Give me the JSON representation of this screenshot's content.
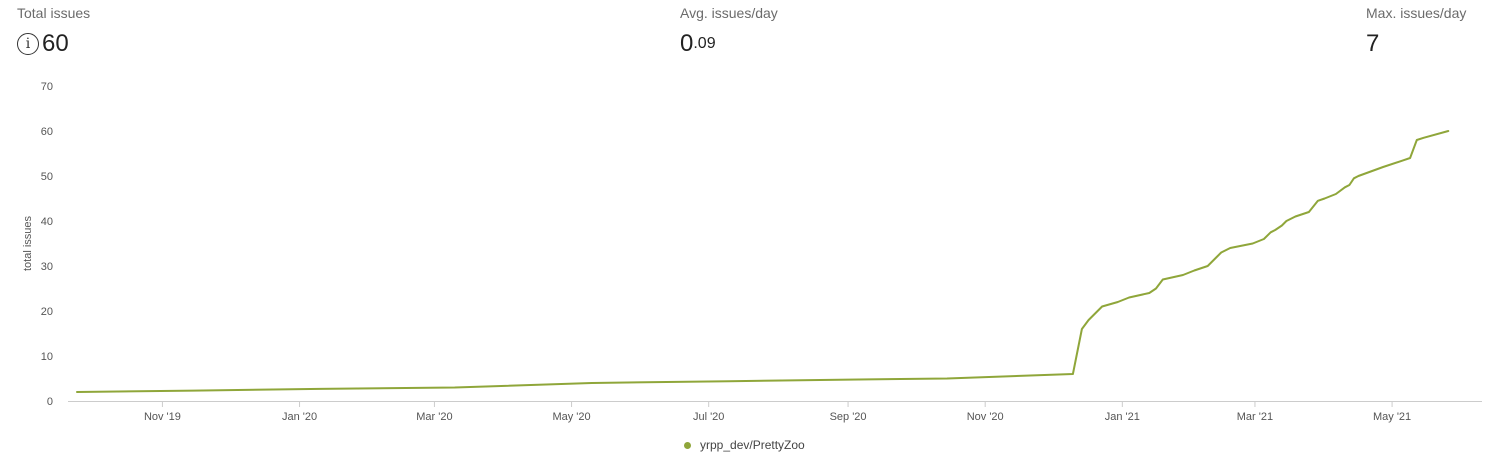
{
  "stats": {
    "total": {
      "label": "Total issues",
      "value": "60",
      "icon": "info-icon",
      "icon_glyph": "i"
    },
    "avg": {
      "label": "Avg. issues/day",
      "int_part": "0",
      "frac_part": ".09"
    },
    "max": {
      "label": "Max. issues/day",
      "value": "7"
    }
  },
  "colors": {
    "series": "#8fa63a",
    "axis": "#cccccc"
  },
  "chart_data": {
    "type": "line",
    "title": "",
    "xlabel": "",
    "ylabel": "total issues",
    "ylim": [
      0,
      70
    ],
    "xlim": [
      "2019-09-20",
      "2021-06-10"
    ],
    "y_ticks": [
      0,
      10,
      20,
      30,
      40,
      50,
      60,
      70
    ],
    "x_ticks": [
      {
        "date": "2019-11-01",
        "label": "Nov '19"
      },
      {
        "date": "2020-01-01",
        "label": "Jan '20"
      },
      {
        "date": "2020-03-01",
        "label": "Mar '20"
      },
      {
        "date": "2020-05-01",
        "label": "May '20"
      },
      {
        "date": "2020-07-01",
        "label": "Jul '20"
      },
      {
        "date": "2020-09-01",
        "label": "Sep '20"
      },
      {
        "date": "2020-11-01",
        "label": "Nov '20"
      },
      {
        "date": "2021-01-01",
        "label": "Jan '21"
      },
      {
        "date": "2021-03-01",
        "label": "Mar '21"
      },
      {
        "date": "2021-05-01",
        "label": "May '21"
      }
    ],
    "grid": false,
    "legend": "bottom",
    "series": [
      {
        "name": "yrpp_dev/PrettyZoo",
        "color": "#8fa63a",
        "points": [
          [
            "2019-09-24",
            2
          ],
          [
            "2019-11-15",
            2.3
          ],
          [
            "2020-01-10",
            2.7
          ],
          [
            "2020-03-10",
            3
          ],
          [
            "2020-05-10",
            4
          ],
          [
            "2020-07-10",
            4.4
          ],
          [
            "2020-09-10",
            4.8
          ],
          [
            "2020-10-15",
            5
          ],
          [
            "2020-12-10",
            6
          ],
          [
            "2020-12-14",
            16
          ],
          [
            "2020-12-17",
            18
          ],
          [
            "2020-12-19",
            19
          ],
          [
            "2020-12-23",
            21
          ],
          [
            "2020-12-30",
            22
          ],
          [
            "2021-01-04",
            23
          ],
          [
            "2021-01-13",
            24
          ],
          [
            "2021-01-16",
            25
          ],
          [
            "2021-01-19",
            27
          ],
          [
            "2021-01-28",
            28
          ],
          [
            "2021-02-02",
            29
          ],
          [
            "2021-02-08",
            30
          ],
          [
            "2021-02-12",
            32
          ],
          [
            "2021-02-14",
            33
          ],
          [
            "2021-02-18",
            34
          ],
          [
            "2021-02-28",
            35
          ],
          [
            "2021-03-05",
            36
          ],
          [
            "2021-03-08",
            37.5
          ],
          [
            "2021-03-10",
            38
          ],
          [
            "2021-03-13",
            39
          ],
          [
            "2021-03-15",
            40
          ],
          [
            "2021-03-19",
            41
          ],
          [
            "2021-03-25",
            42
          ],
          [
            "2021-03-29",
            44.5
          ],
          [
            "2021-04-01",
            45
          ],
          [
            "2021-04-06",
            46
          ],
          [
            "2021-04-10",
            47.5
          ],
          [
            "2021-04-12",
            48
          ],
          [
            "2021-04-14",
            49.5
          ],
          [
            "2021-04-16",
            50
          ],
          [
            "2021-04-27",
            52
          ],
          [
            "2021-05-06",
            53.5
          ],
          [
            "2021-05-09",
            54
          ],
          [
            "2021-05-12",
            58
          ],
          [
            "2021-05-15",
            58.5
          ],
          [
            "2021-05-26",
            60
          ]
        ]
      }
    ]
  }
}
